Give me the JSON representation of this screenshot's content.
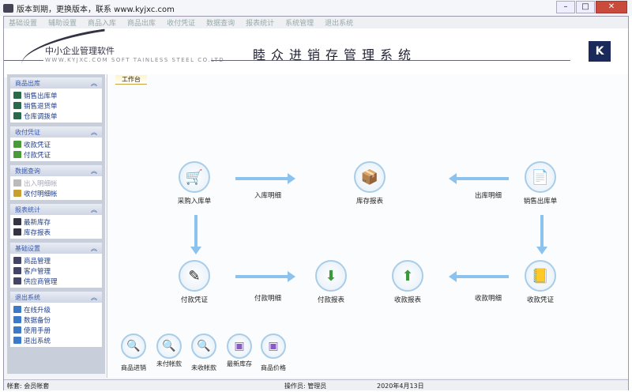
{
  "window": {
    "title": "版本到期，更换版本，联系 www.kyjxc.com"
  },
  "menu": [
    "基础设置",
    "辅助设置",
    "商品入库",
    "商品出库",
    "收付凭证",
    "数据查询",
    "报表统计",
    "系统管理",
    "退出系统"
  ],
  "banner": {
    "logo_cn": "中小企业管理软件",
    "logo_en": "WWW.KYJXC.COM  SOFT  TAINLESS  STEEL  CO.LTD",
    "title": "睦众进销存管理系统"
  },
  "sidebar": [
    {
      "title": "商品出库",
      "items": [
        "销售出库单",
        "销售退货单",
        "仓库调拨单"
      ]
    },
    {
      "title": "收付凭证",
      "items": [
        "收款凭证",
        "付款凭证"
      ]
    },
    {
      "title": "数据查询",
      "items": [
        "出入明细帐",
        "收付明细帐"
      ]
    },
    {
      "title": "报表统计",
      "items": [
        "最新库存",
        "库存报表"
      ]
    },
    {
      "title": "基础设置",
      "items": [
        "商品管理",
        "客户管理",
        "供应商管理"
      ]
    },
    {
      "title": "退出系统",
      "items": [
        "在线升级",
        "数据备份",
        "使用手册",
        "退出系统"
      ]
    }
  ],
  "tab": "工作台",
  "flow": {
    "purchase_in": "采购入库单",
    "stock_report": "库存报表",
    "sales_out": "销售出库单",
    "pay_voucher": "付款凭证",
    "pay_report": "付款报表",
    "receipt_report": "收款报表",
    "receipt_voucher": "收款凭证",
    "in_detail": "入库明细",
    "out_detail": "出库明细",
    "pay_detail": "付款明细",
    "receipt_detail": "收款明细"
  },
  "quick": [
    "商品进销",
    "未付帐款",
    "未收帐款",
    "最新库存",
    "商品价格"
  ],
  "status": {
    "account": "帐套: 会员帐套",
    "operator": "操作员: 管理员",
    "date": "2020年4月13日"
  }
}
